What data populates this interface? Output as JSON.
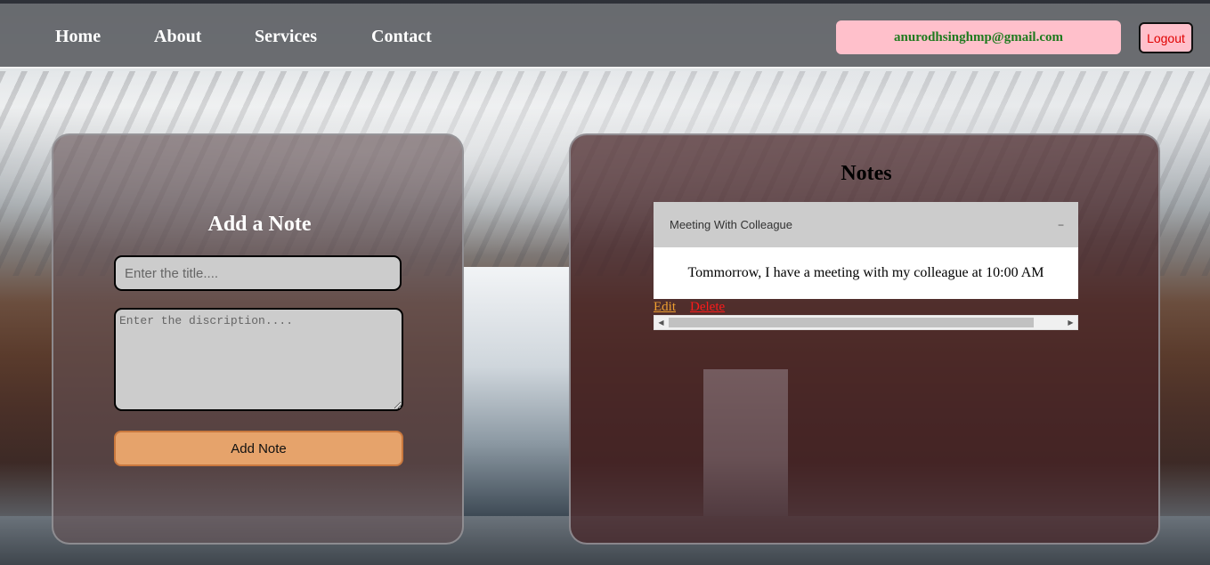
{
  "nav": {
    "links": [
      "Home",
      "About",
      "Services",
      "Contact"
    ],
    "user_email": "anurodhsinghmp@gmail.com",
    "logout_label": "Logout"
  },
  "add_note": {
    "heading": "Add a Note",
    "title_placeholder": "Enter the title....",
    "description_placeholder": "Enter the discription....",
    "button_label": "Add Note"
  },
  "notes": {
    "heading": "Notes",
    "items": [
      {
        "title": "Meeting With Colleague",
        "description": "Tommorrow, I have a meeting with my colleague at 10:00 AM",
        "edit_label": "Edit",
        "delete_label": "Delete",
        "collapse_icon": "−"
      }
    ]
  },
  "colors": {
    "email_badge_bg": "#ffc0cb",
    "email_text": "#1e7a1e",
    "logout_text": "#e00000",
    "add_button_bg": "#e6a36b",
    "edit_link": "#f0a030",
    "delete_link": "#ff1a1a"
  }
}
